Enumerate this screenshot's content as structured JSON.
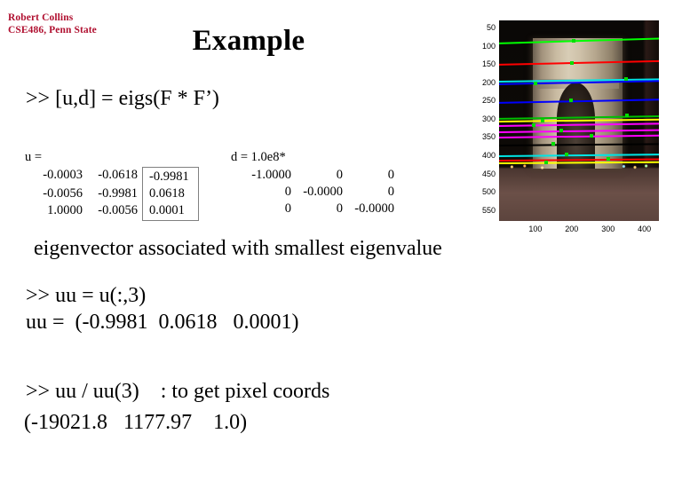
{
  "header": {
    "author": "Robert Collins",
    "affiliation": "CSE486, Penn State",
    "color": "#b01030"
  },
  "title": "Example",
  "body": {
    "cmd_eigs": ">> [u,d] = eigs(F * F’)",
    "caption_eigvec": "eigenvector associated with smallest eigenvalue",
    "cmd_uu": ">> uu = u(:,3)",
    "out_uu": "uu =  (-0.9981  0.0618   0.0001)",
    "cmd_div": ">> uu / uu(3)    : to get pixel coords",
    "out_div": "(-19021.8   1177.97    1.0)"
  },
  "matrices": {
    "u": {
      "label": "u =",
      "rows": [
        [
          "-0.0003",
          "-0.0618",
          "-0.9981"
        ],
        [
          "-0.0056",
          "-0.9981",
          "0.0618"
        ],
        [
          "1.0000",
          "-0.0056",
          "0.0001"
        ]
      ],
      "highlight_column": 3,
      "highlight_border_color": "#808080"
    },
    "d": {
      "label": "d = 1.0e8*",
      "rows": [
        [
          "-1.0000",
          "0",
          "0"
        ],
        [
          "0",
          "-0.0000",
          "0"
        ],
        [
          "0",
          "0",
          "-0.0000"
        ]
      ]
    }
  },
  "figure": {
    "name": "arc-de-triomphe-night-photo",
    "yticks": [
      50,
      100,
      150,
      200,
      250,
      300,
      350,
      400,
      450,
      500,
      550
    ],
    "xticks": [
      100,
      200,
      300,
      400
    ],
    "xlim": [
      0,
      440
    ],
    "ylim": [
      30,
      580
    ],
    "lines": [
      {
        "color": "#00ff00",
        "y": 92,
        "slope": -0.03,
        "mark_x": 205
      },
      {
        "color": "#ff0000",
        "y": 150,
        "slope": -0.022,
        "mark_x": 200
      },
      {
        "color": "#00e5e5",
        "y": 196,
        "slope": -0.014,
        "mark_x": 350
      },
      {
        "color": "#0000ff",
        "y": 204,
        "slope": -0.02,
        "mark_x": 100
      },
      {
        "color": "#0000ff",
        "y": 254,
        "slope": -0.02,
        "mark_x": 198
      },
      {
        "color": "#00c000",
        "y": 297,
        "slope": -0.016,
        "mark_x": 352
      },
      {
        "color": "#ffff00",
        "y": 306,
        "slope": -0.012,
        "mark_x": 120
      },
      {
        "color": "#ff00ff",
        "y": 318,
        "slope": -0.014,
        "mark_x": 96
      },
      {
        "color": "#ff00ff",
        "y": 334,
        "slope": -0.013,
        "mark_x": 170
      },
      {
        "color": "#ff00ff",
        "y": 350,
        "slope": -0.012,
        "mark_x": 255
      },
      {
        "color": "#000000",
        "y": 370,
        "slope": -0.009,
        "mark_x": 150
      },
      {
        "color": "#00e5e5",
        "y": 400,
        "slope": -0.01,
        "mark_x": 185
      },
      {
        "color": "#ff0000",
        "y": 413,
        "slope": -0.008,
        "mark_x": 300
      },
      {
        "color": "#ffff00",
        "y": 420,
        "slope": -0.007,
        "mark_x": 130
      }
    ]
  }
}
